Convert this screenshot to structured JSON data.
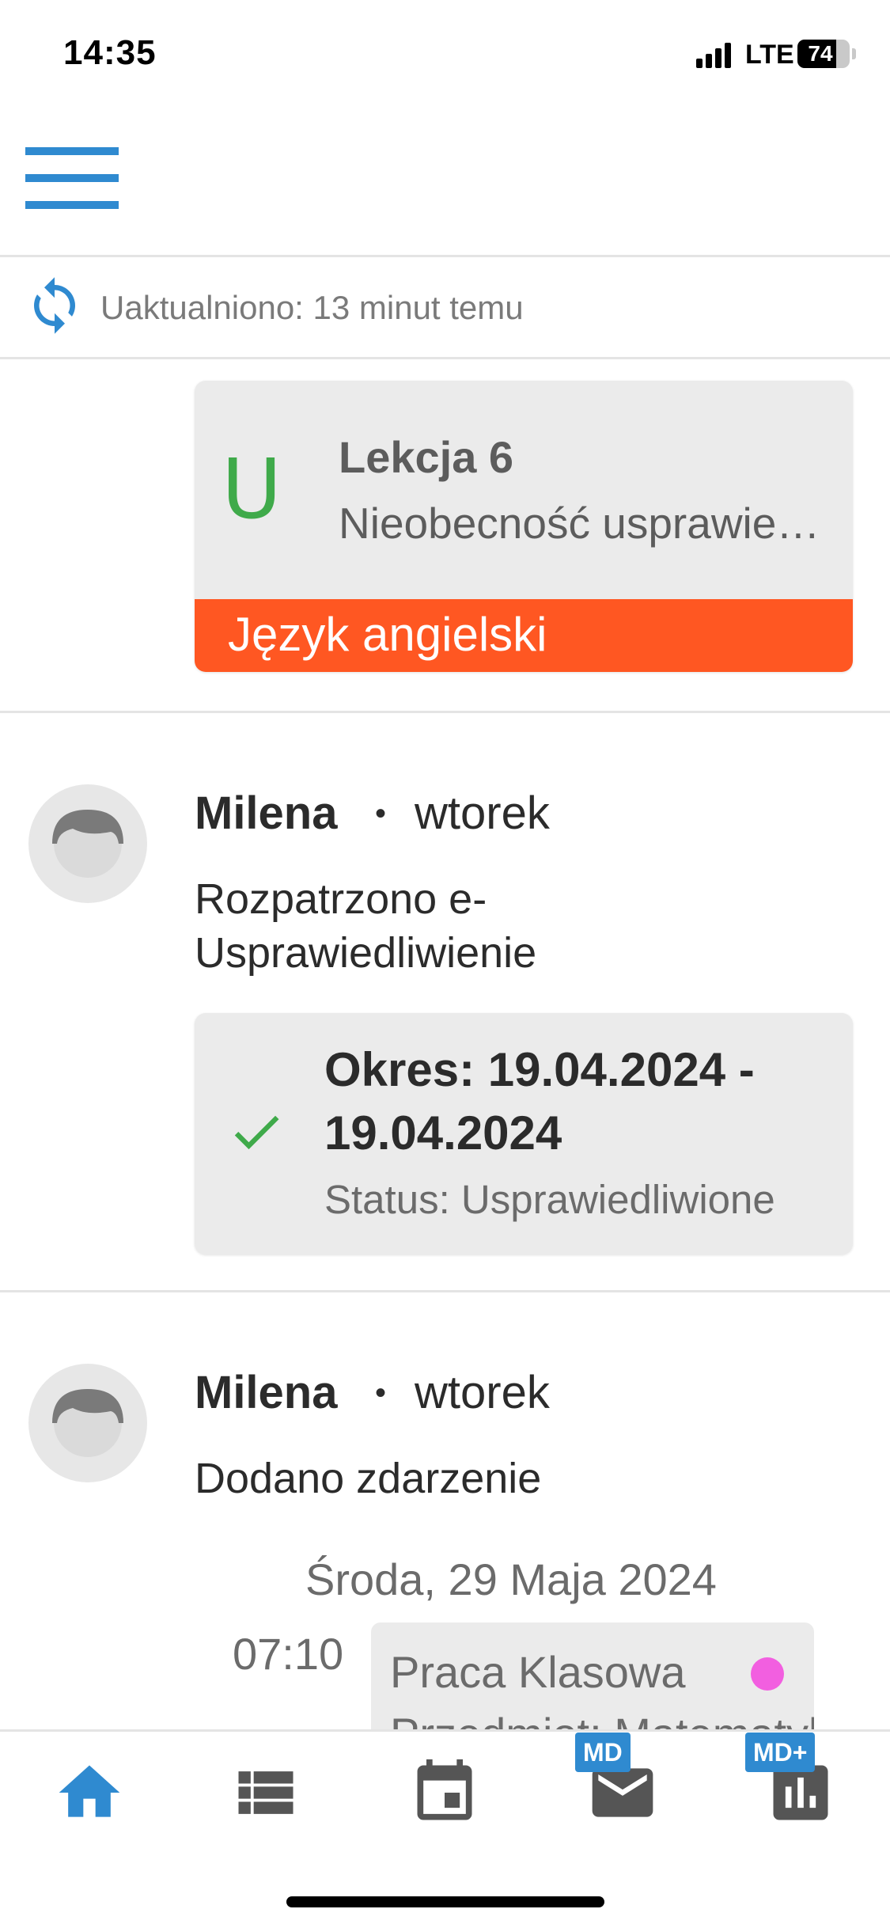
{
  "status_bar": {
    "time": "14:35",
    "network": "LTE",
    "battery": "74",
    "battery_level": 0.74
  },
  "header": {
    "menu_icon": "hamburger-menu-icon",
    "accent_color": "#2f8ad0"
  },
  "update_bar": {
    "icon": "sync-icon",
    "text": "Uaktualniono: 13 minut temu"
  },
  "feed": {
    "lesson_card": {
      "letter": "U",
      "letter_color": "#3faa4a",
      "title": "Lekcja 6",
      "description": "Nieobecność usprawiedliwiona",
      "subject": "Język angielski",
      "subject_color": "#ff5722"
    },
    "items": [
      {
        "author": "Milena",
        "separator": "•",
        "day": "wtorek",
        "action_line1": "Rozpatrzono e-",
        "action_line2": "Usprawiedliwienie",
        "card": {
          "icon": "checkmark-icon",
          "title": "Okres: 19.04.2024 - 19.04.2024",
          "status": "Status: Usprawiedliwione"
        }
      },
      {
        "author": "Milena",
        "separator": "•",
        "day": "wtorek",
        "action_line1": "Dodano zdarzenie",
        "event": {
          "date": "Środa, 29 Maja 2024",
          "time": "07:10",
          "title": "Praca Klasowa",
          "subject": "Przedmiot: Matematyka",
          "dot_color": "#f25fe0"
        }
      }
    ]
  },
  "bottom_nav": {
    "items": [
      {
        "name": "home",
        "icon": "home-icon",
        "active": true
      },
      {
        "name": "list",
        "icon": "list-icon",
        "active": false
      },
      {
        "name": "calendar",
        "icon": "calendar-icon",
        "active": false
      },
      {
        "name": "messages",
        "icon": "mail-icon",
        "badge": "MD",
        "active": false
      },
      {
        "name": "grades",
        "icon": "bar-chart-icon",
        "badge": "MD+",
        "active": false
      }
    ],
    "active_color": "#2f8ad0",
    "inactive_color": "#555555"
  }
}
